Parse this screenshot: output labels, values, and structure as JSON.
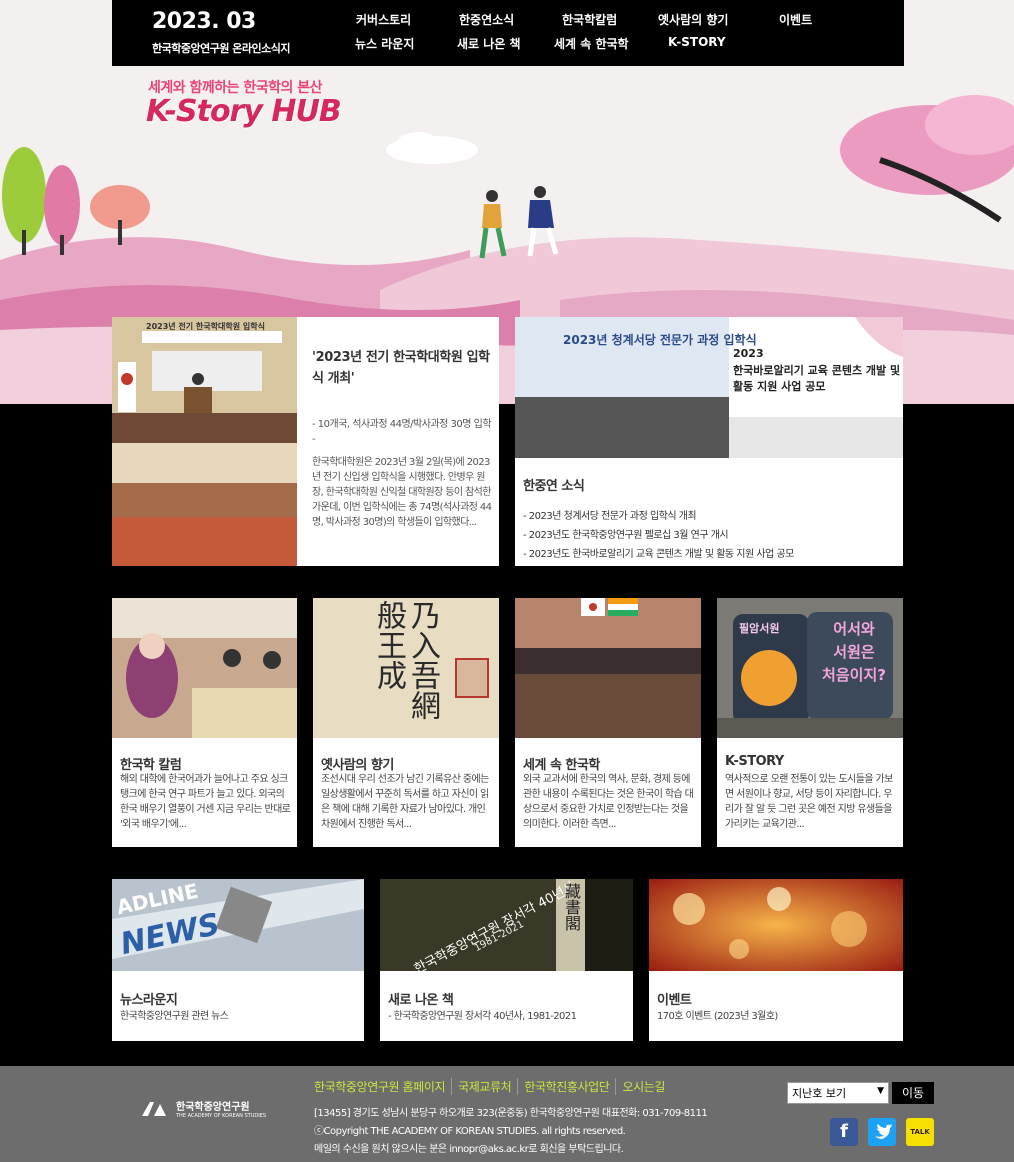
{
  "header": {
    "issue_date": "2023. 03",
    "issue_subtitle": "한국학중앙연구원 온라인소식지",
    "nav": [
      "커버스토리",
      "한중연소식",
      "한국학칼럼",
      "옛사람의 향기",
      "이벤트",
      "뉴스 라운지",
      "새로 나온 책",
      "세계 속 한국학",
      "K-STORY"
    ]
  },
  "hero": {
    "tagline": "세계와 함께하는 한국학의 본산",
    "logo": "K-Story HUB"
  },
  "feature": {
    "title": "'2023년 전기 한국학대학원 입학식 개최'",
    "subtitle": "- 10개국, 석사과정 44명/박사과정 30명 입학 -",
    "body": "한국학대학원은 2023년 3월 2일(목)에 2023년 전기 신입생 입학식을 시행했다. 안병우 원장, 한국학대학원 신익철 대학원장 등이 참석한 가운데, 이번 입학식에는 총 74명(석사과정 44명, 박사과정 30명)의 학생들이 입학했다...",
    "photo_caption": "2023년 전기 한국학대학원 입학식"
  },
  "akso_news": {
    "title": "한중연 소식",
    "items": [
      "- 2023년 청계서당 전문가 과정 입학식 개최",
      "- 2023년도 한국학중앙연구원 펠로십 3월 연구 개시",
      "- 2023년도 한국바로알리기 교육 콘텐츠 개발 및 활동 지원 사업 공모"
    ],
    "photo_banner": "2023년 청계서당 전문가 과정 입학식",
    "poster_year": "2023",
    "poster_title": "한국바로알리기 교육 콘텐츠 개발 및 활동 지원 사업 공모"
  },
  "cards": [
    {
      "title": "한국학 칼럼",
      "text": "해외 대학에 한국어과가 늘어나고 주요 싱크탱크에 한국 연구 파트가 늘고 있다. 외국의 한국 배우기 열풍이 거센 지금 우리는 반대로 '외국 배우기'에..."
    },
    {
      "title": "옛사람의 향기",
      "text": "조선시대 우리 선조가 남긴 기록유산 중에는 일상생활에서 꾸준히 독서를 하고 자신이 읽은 책에 대해 기록한 자료가 남아있다. 개인 차원에서 진행한 독서..."
    },
    {
      "title": "세계 속 한국학",
      "text": "외국 교과서에 한국의 역사, 문화, 경제 등에 관한 내용이 수록된다는 것은 한국이 학습 대상으로서 중요한 가치로 인정받는다는 것을 의미한다. 이러한 측면..."
    },
    {
      "title": "K-STORY",
      "text": "역사적으로 오랜 전통이 있는 도시들을 가보면 서원이나 향교, 서당 등이 자리합니다. 우리가 잘 알 듯 그런 곳은 예전 지방 유생들을 가리키는 교육기관..."
    }
  ],
  "kstory_sign": {
    "line1": "어서와",
    "line2": "서원은",
    "line3": "처음이지?",
    "left": "필암서원"
  },
  "bottom_cards": [
    {
      "title": "뉴스라운지",
      "text": "한국학중앙연구원 관련 뉴스",
      "photo_text": "NEWS",
      "photo_text2": "ADLINE"
    },
    {
      "title": "새로 나온 책",
      "text": "- 한국학중앙연구원 장서각 40년사, 1981-2021",
      "book_title": "한국학중앙연구원 장서각 40년사",
      "book_years": "1981-2021",
      "seal": "藏書閣"
    },
    {
      "title": "이벤트",
      "text": "170호 이벤트 (2023년 3월호)"
    }
  ],
  "calligraphy": "乃入吾網 般王成",
  "footer": {
    "logo_text": "한국학중앙연구원",
    "logo_sub": "THE ACADEMY OF KOREAN STUDIES",
    "links": [
      "한국학중앙연구원 홈페이지",
      "국제교류처",
      "한국학진흥사업단",
      "오시는길"
    ],
    "address": "[13455] 경기도 성남시 분당구 하오개로 323(운중동) 한국학중앙연구원 대표전화: 031-709-8111",
    "copyright": "ⓒCopyright THE ACADEMY OF KOREAN STUDIES. all rights reserved.",
    "notice": "메일의 수신을 원치 않으시는 분은 innopr@aks.ac.kr로 회신을 부탁드립니다.",
    "select_label": "지난호 보기",
    "go_label": "이동",
    "sns": [
      "facebook-icon",
      "twitter-icon",
      "kakaotalk-icon"
    ],
    "kakao_label": "TALK"
  },
  "colors": {
    "accent": "#d4285f",
    "footer_bg": "#6d6d6d",
    "footer_link": "#cbe63c"
  }
}
